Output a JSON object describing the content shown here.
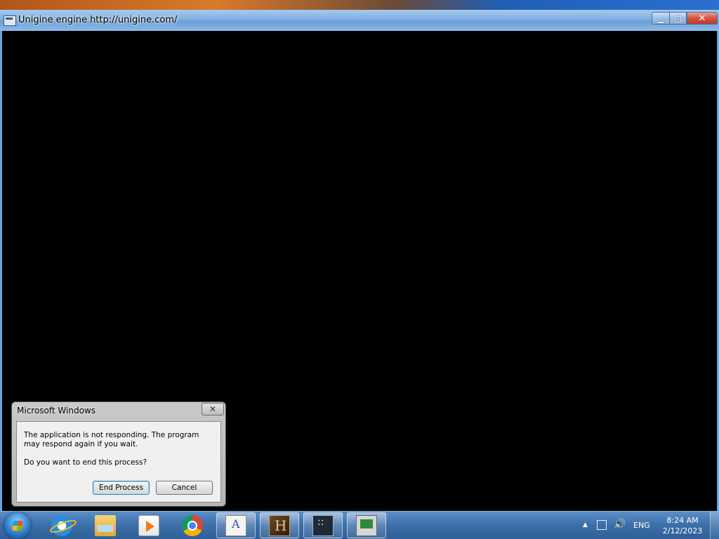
{
  "app_window": {
    "title": "Unigine engine http://unigine.com/",
    "controls": {
      "minimize": "▁",
      "maximize": "□",
      "close": "✕"
    }
  },
  "dialog": {
    "title": "Microsoft Windows",
    "close": "✕",
    "message": "The application is not responding. The program may respond again if you wait.",
    "question": "Do you want to end this process?",
    "end_button": "End Process",
    "cancel_button": "Cancel"
  },
  "taskbar": {
    "items": [
      {
        "icon": "internet-explorer-icon"
      },
      {
        "icon": "folder-icon"
      },
      {
        "icon": "media-player-icon"
      },
      {
        "icon": "chrome-icon"
      },
      {
        "icon": "document-icon",
        "active": true
      },
      {
        "icon": "game-icon",
        "active": true
      },
      {
        "icon": "unigine-icon",
        "active": true
      },
      {
        "icon": "monitor-icon",
        "active": true
      }
    ],
    "tray": {
      "show_hidden": "▲",
      "volume": "🔊",
      "language": "ENG",
      "time": "8:24 AM",
      "date": "2/12/2023"
    }
  }
}
